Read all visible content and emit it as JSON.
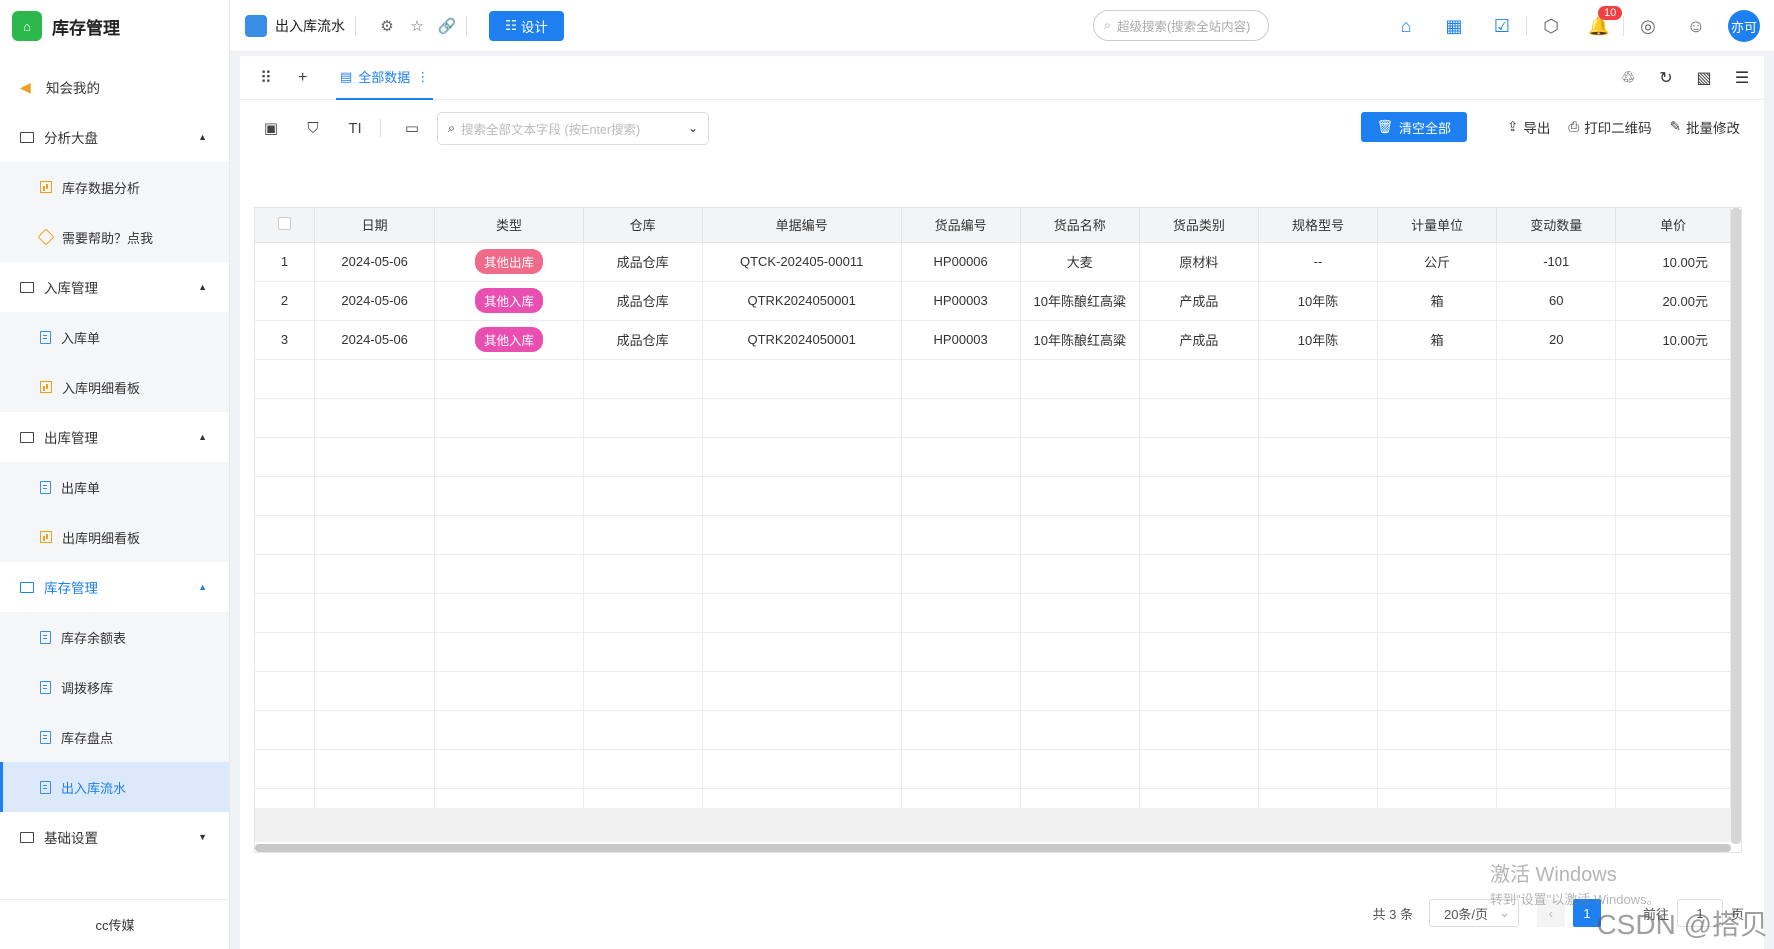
{
  "app": {
    "title": "库存管理"
  },
  "sidebar": {
    "top_item": "知会我的",
    "groups": [
      {
        "label": "分析大盘",
        "items": [
          "库存数据分析",
          "需要帮助？点我"
        ]
      },
      {
        "label": "入库管理",
        "items": [
          "入库单",
          "入库明细看板"
        ]
      },
      {
        "label": "出库管理",
        "items": [
          "出库单",
          "出库明细看板"
        ]
      },
      {
        "label": "库存管理",
        "items": [
          "库存余额表",
          "调拨移库",
          "库存盘点",
          "出入库流水"
        ]
      },
      {
        "label": "基础设置",
        "items": []
      }
    ],
    "footer": "cc传媒"
  },
  "topbar": {
    "page_title": "出入库流水",
    "design_label": "设计",
    "search_placeholder": "超级搜索(搜索全站内容)",
    "notification_count": "10",
    "avatar_text": "亦可"
  },
  "tabs": {
    "active_label": "全部数据"
  },
  "toolbar": {
    "search_placeholder": "搜索全部文本字段 (按Enter搜索)",
    "clear_all": "清空全部",
    "export": "导出",
    "print_qr": "打印二维码",
    "batch_edit": "批量修改"
  },
  "table": {
    "columns": [
      "日期",
      "类型",
      "仓库",
      "单据编号",
      "货品编号",
      "货品名称",
      "货品类别",
      "规格型号",
      "计量单位",
      "变动数量",
      "单价"
    ],
    "rows": [
      {
        "idx": "1",
        "date": "2024-05-06",
        "type": "其他出库",
        "warehouse": "成品仓库",
        "doc_no": "QTCK-202405-00011",
        "item_no": "HP00006",
        "item_name": "大麦",
        "category": "原材料",
        "spec": "--",
        "unit": "公斤",
        "qty": "-101",
        "price": "10.00元"
      },
      {
        "idx": "2",
        "date": "2024-05-06",
        "type": "其他入库",
        "warehouse": "成品仓库",
        "doc_no": "QTRK2024050001",
        "item_no": "HP00003",
        "item_name": "10年陈酿红高粱",
        "category": "产成品",
        "spec": "10年陈",
        "unit": "箱",
        "qty": "60",
        "price": "20.00元"
      },
      {
        "idx": "3",
        "date": "2024-05-06",
        "type": "其他入库",
        "warehouse": "成品仓库",
        "doc_no": "QTRK2024050001",
        "item_no": "HP00003",
        "item_name": "10年陈酿红高粱",
        "category": "产成品",
        "spec": "10年陈",
        "unit": "箱",
        "qty": "20",
        "price": "10.00元"
      }
    ]
  },
  "pagination": {
    "total": "共 3 条",
    "page_size": "20条/页",
    "current": "1",
    "goto_label": "前往",
    "goto_value": "1",
    "page_suffix": "页"
  },
  "overlay": {
    "windows_line1": "激活 Windows",
    "windows_line2": "转到\"设置\"以激活 Windows。",
    "csdn": "CSDN @搭贝"
  },
  "colors": {
    "accent": "#1e80f0",
    "brand_green": "#2db84d",
    "pill_out": "#f06a8a",
    "pill_in": "#e84fb0"
  }
}
